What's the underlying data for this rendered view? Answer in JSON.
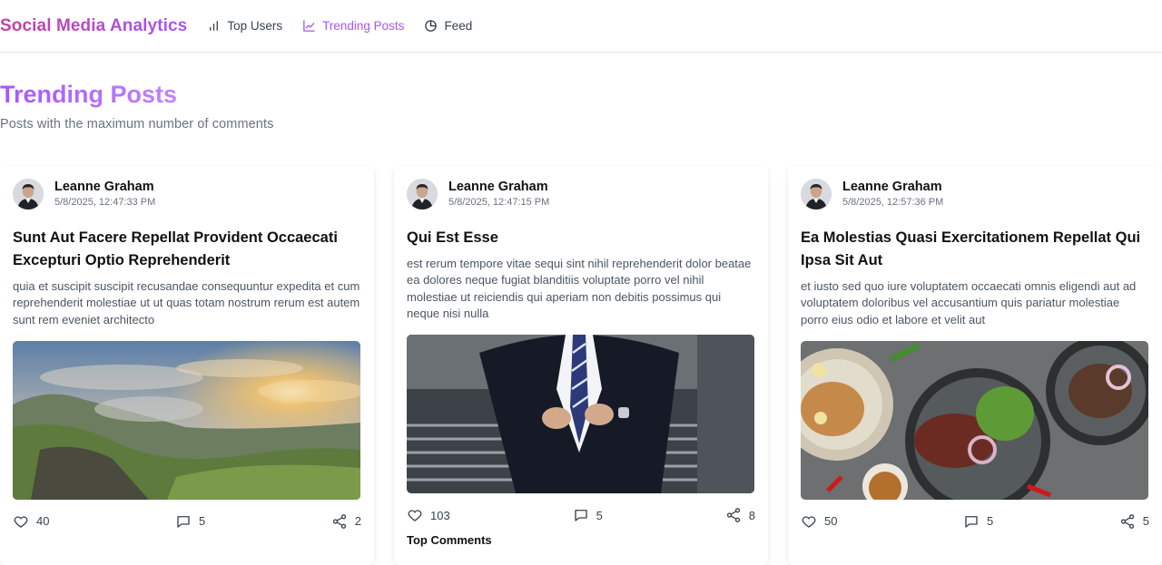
{
  "app": {
    "brand": "Social Media Analytics"
  },
  "nav": {
    "items": [
      {
        "label": "Top Users",
        "icon": "bar-chart-icon"
      },
      {
        "label": "Trending Posts",
        "icon": "line-chart-icon",
        "active": true
      },
      {
        "label": "Feed",
        "icon": "pie-chart-icon"
      }
    ]
  },
  "header": {
    "title": "Trending Posts",
    "subtitle": "Posts with the maximum number of comments"
  },
  "colors": {
    "accent": "#a855f7",
    "brand_start": "#c53f9e"
  },
  "posts": [
    {
      "author": "Leanne Graham",
      "time": "5/8/2025, 12:47:33 PM",
      "title": "Sunt Aut Facere Repellat Provident Occaecati Excepturi Optio Reprehenderit",
      "body": "quia et suscipit suscipit recusandae consequuntur expedita et cum reprehenderit molestiae ut ut quas totam nostrum rerum est autem sunt rem eveniet architecto",
      "image": "landscape-photo",
      "likes": "40",
      "comments": "5",
      "shares": "2"
    },
    {
      "author": "Leanne Graham",
      "time": "5/8/2025, 12:47:15 PM",
      "title": "Qui Est Esse",
      "body": "est rerum tempore vitae sequi sint nihil reprehenderit dolor beatae ea dolores neque fugiat blanditiis voluptate porro vel nihil molestiae ut reiciendis qui aperiam non debitis possimus qui neque nisi nulla",
      "image": "businessman-photo",
      "likes": "103",
      "comments": "5",
      "shares": "8",
      "extra": "Top Comments"
    },
    {
      "author": "Leanne Graham",
      "time": "5/8/2025, 12:57:36 PM",
      "title": "Ea Molestias Quasi Exercitationem Repellat Qui Ipsa Sit Aut",
      "body": "et iusto sed quo iure voluptatem occaecati omnis eligendi aut ad voluptatem doloribus vel accusantium quis pariatur molestiae porro eius odio et labore et velit aut",
      "image": "food-photo",
      "likes": "50",
      "comments": "5",
      "shares": "5"
    }
  ]
}
